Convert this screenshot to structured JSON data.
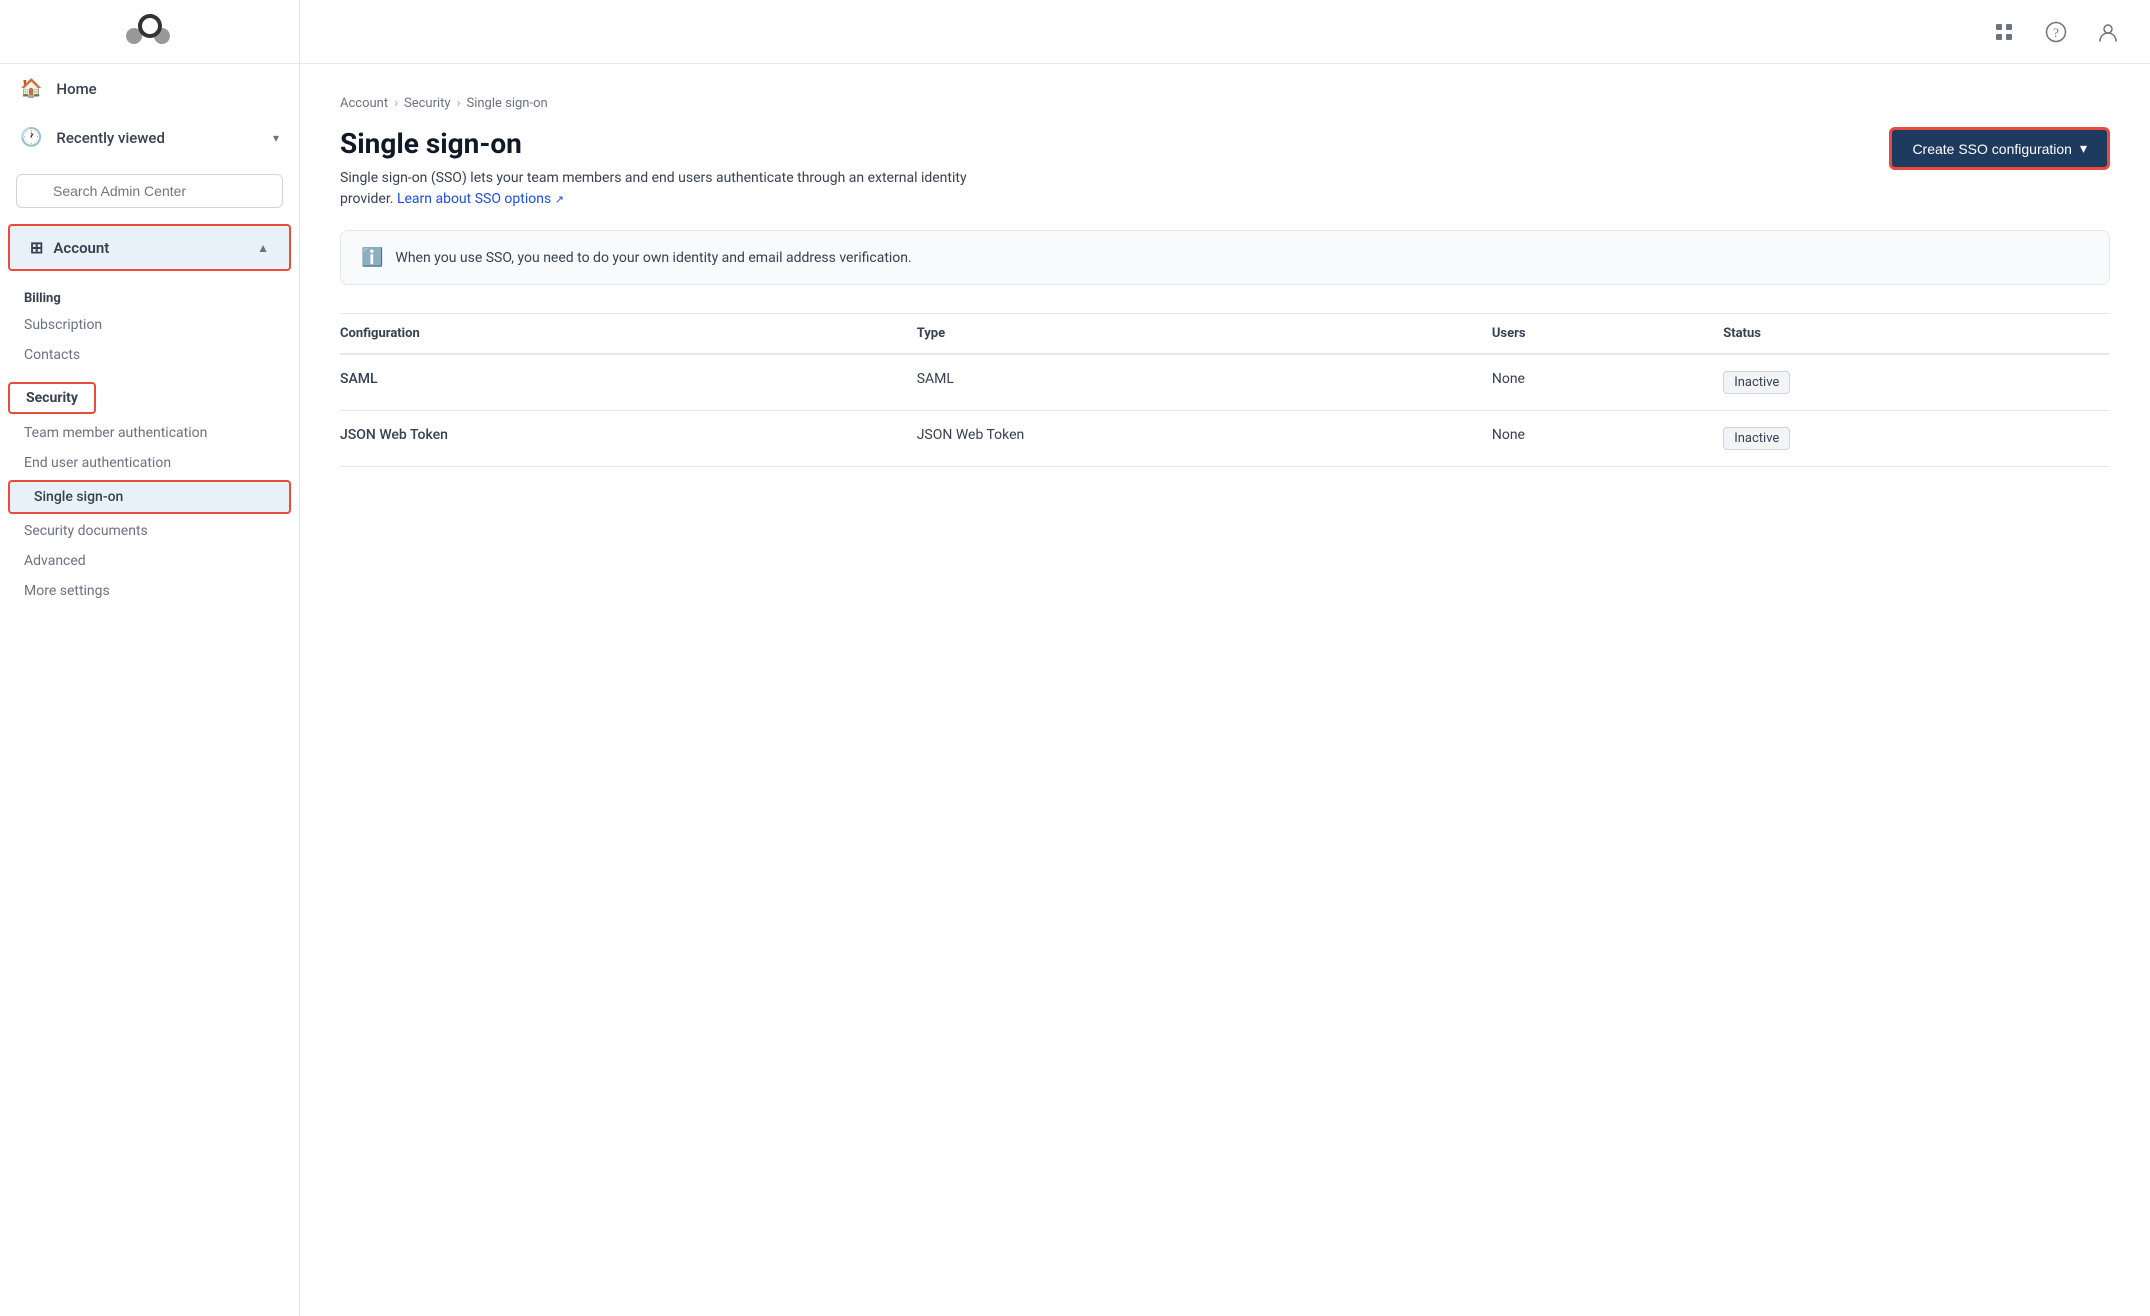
{
  "sidebar": {
    "logo_alt": "Zendesk logo",
    "nav_items": [
      {
        "id": "home",
        "label": "Home",
        "icon": "🏠"
      },
      {
        "id": "recently-viewed",
        "label": "Recently viewed",
        "icon": "🕐",
        "has_chevron": true
      }
    ],
    "search": {
      "placeholder": "Search Admin Center"
    },
    "sections": [
      {
        "id": "account",
        "label": "Account",
        "icon": "⊞",
        "active": true,
        "expanded": true,
        "groups": [
          {
            "label": "Billing",
            "items": [
              {
                "id": "subscription",
                "label": "Subscription",
                "active": false
              },
              {
                "id": "contacts",
                "label": "Contacts",
                "active": false
              }
            ]
          },
          {
            "label": "Security",
            "is_section_header": true,
            "items": [
              {
                "id": "team-member-auth",
                "label": "Team member authentication",
                "active": false
              },
              {
                "id": "end-user-auth",
                "label": "End user authentication",
                "active": false
              },
              {
                "id": "single-sign-on",
                "label": "Single sign-on",
                "active": true
              },
              {
                "id": "security-documents",
                "label": "Security documents",
                "active": false
              },
              {
                "id": "advanced",
                "label": "Advanced",
                "active": false
              },
              {
                "id": "more-settings",
                "label": "More settings",
                "active": false
              }
            ]
          }
        ]
      }
    ]
  },
  "topbar": {
    "grid_icon": "grid",
    "help_icon": "help",
    "user_icon": "user"
  },
  "breadcrumb": {
    "items": [
      "Account",
      "Security",
      "Single sign-on"
    ]
  },
  "page": {
    "title": "Single sign-on",
    "description": "Single sign-on (SSO) lets your team members and end users authenticate through an external identity provider.",
    "learn_more_text": "Learn about SSO options",
    "create_button_label": "Create SSO configuration",
    "info_message": "When you use SSO, you need to do your own identity and email address verification.",
    "table": {
      "columns": [
        "Configuration",
        "Type",
        "Users",
        "Status"
      ],
      "rows": [
        {
          "configuration": "SAML",
          "type": "SAML",
          "users": "None",
          "status": "Inactive"
        },
        {
          "configuration": "JSON Web Token",
          "type": "JSON Web Token",
          "users": "None",
          "status": "Inactive"
        }
      ]
    }
  }
}
